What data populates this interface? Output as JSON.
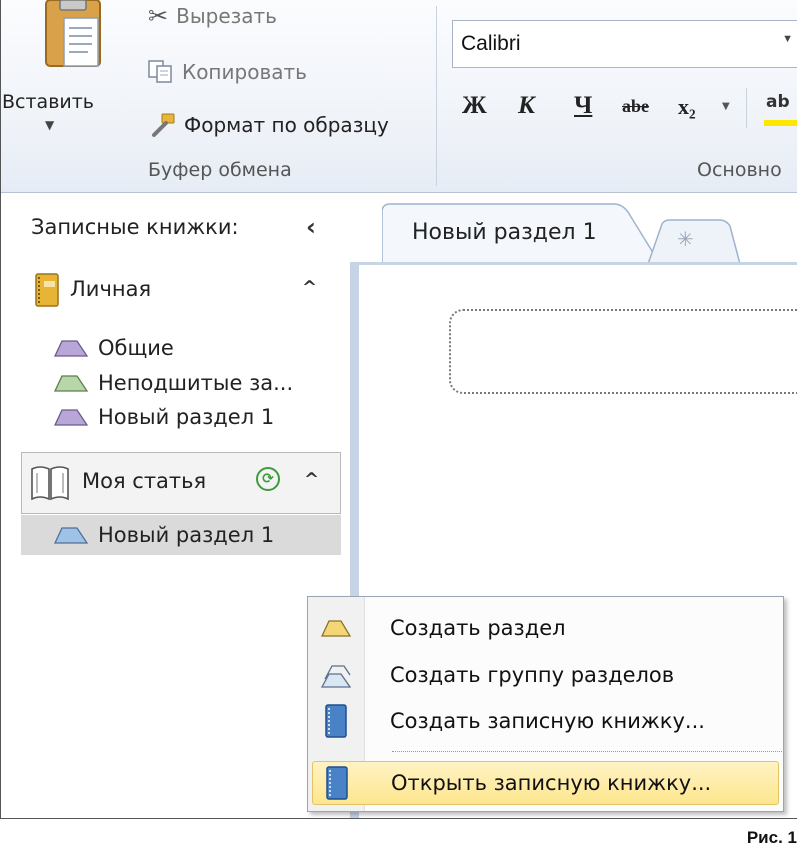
{
  "ribbon": {
    "clipboard": {
      "paste_label": "Вставить",
      "cut_label": "Вырезать",
      "copy_label": "Копировать",
      "format_painter_label": "Формат по образцу",
      "group_label": "Буфер обмена"
    },
    "font": {
      "font_name": "Calibri",
      "bold_glyph": "Ж",
      "italic_glyph": "К",
      "underline_glyph": "Ч",
      "strike_glyph": "abe",
      "subscript_glyph": "x₂",
      "highlight_glyph": "ab",
      "group_label": "Основно"
    }
  },
  "nav": {
    "header_label": "Записные книжки:",
    "notebooks": [
      {
        "name": "Личная",
        "sections": [
          {
            "name": "Общие",
            "color": "#b9a6d8"
          },
          {
            "name": "Неподшитые за...",
            "color": "#b7d7a8"
          },
          {
            "name": "Новый раздел 1",
            "color": "#b9a6d8"
          }
        ]
      },
      {
        "name": "Моя статья",
        "sections": [
          {
            "name": "Новый раздел 1",
            "color": "#9fc3e6"
          }
        ]
      }
    ]
  },
  "tabs": {
    "active_label": "Новый раздел 1"
  },
  "context_menu": {
    "items": [
      {
        "label": "Создать раздел",
        "icon": "section-icon"
      },
      {
        "label": "Создать группу разделов",
        "icon": "section-group-icon"
      },
      {
        "label": "Создать записную книжку...",
        "icon": "notebook-icon"
      },
      {
        "label": "Открыть записную книжку...",
        "icon": "notebook-icon"
      }
    ]
  },
  "caption": "Рис. 1"
}
